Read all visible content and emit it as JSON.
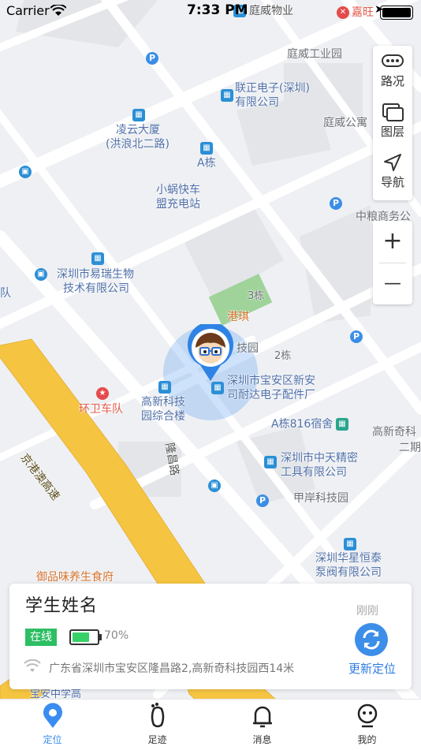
{
  "status_bar": {
    "carrier": "Carrier",
    "time": "7:33 PM"
  },
  "map": {
    "labels": {
      "tingwei_property": "庭威物业",
      "jiawang": "嘉旺",
      "tingwei_industrial": "庭威工业园",
      "lianzheng_1": "联正电子(深圳)",
      "lianzheng_2": "有限公司",
      "tingwei_apt": "庭威公寓",
      "lingyun_1": "凌云大厦",
      "lingyun_2": "(洪浪北二路)",
      "a_building": "A栋",
      "xiaowo_1": "小蜗快车",
      "xiaowo_2": "盟充电站",
      "zhongliang": "中粮商务公",
      "yiruibio_1": "深圳市易瑞生物",
      "yiruibio_2": "技术有限公司",
      "dui": "队",
      "bldg3": "3栋",
      "gangqi": "港琪",
      "tech_park": "技园",
      "bldg2": "2栋",
      "xinan_1": "深圳市宝安区新安",
      "xinan_2": "司耐达电子配件厂",
      "huanwei": "环卫车队",
      "gaoxin_1": "高新科技",
      "gaoxin_2": "园综合楼",
      "a816": "A栋816宿舍",
      "gaoxinqi_1": "高新奇科",
      "gaoxinqi_2": "二期",
      "expressway": "京港澳高速",
      "longchang": "隆昌路",
      "zhongtian_1": "深圳市中天精密",
      "zhongtian_2": "工具有限公司",
      "jia_an": "甲岸科技园",
      "yuping": "御品味养生食府",
      "huaxing_1": "深圳华星恒泰",
      "huaxing_2": "泵阀有限公司",
      "school": "宝安中学高"
    }
  },
  "map_controls": {
    "traffic": "路况",
    "layers": "图层",
    "navigate": "导航",
    "zoom_in": "+",
    "zoom_out": "—"
  },
  "student_card": {
    "name": "学生姓名",
    "recent": "刚刚",
    "status": "在线",
    "battery_percent": "70%",
    "battery_level": 0.7,
    "address": "广东省深圳市宝安区隆昌路2,高新奇科技园西14米",
    "refresh_label": "更新定位"
  },
  "tabs": [
    {
      "label": "定位",
      "icon": "location-icon",
      "active": true
    },
    {
      "label": "足迹",
      "icon": "footprint-icon",
      "active": false
    },
    {
      "label": "消息",
      "icon": "bell-icon",
      "active": false
    },
    {
      "label": "我的",
      "icon": "profile-icon",
      "active": false
    }
  ],
  "colors": {
    "accent": "#3a8df0",
    "online": "#2dbf63",
    "battery": "#37d168",
    "expressway": "#f5c542"
  }
}
